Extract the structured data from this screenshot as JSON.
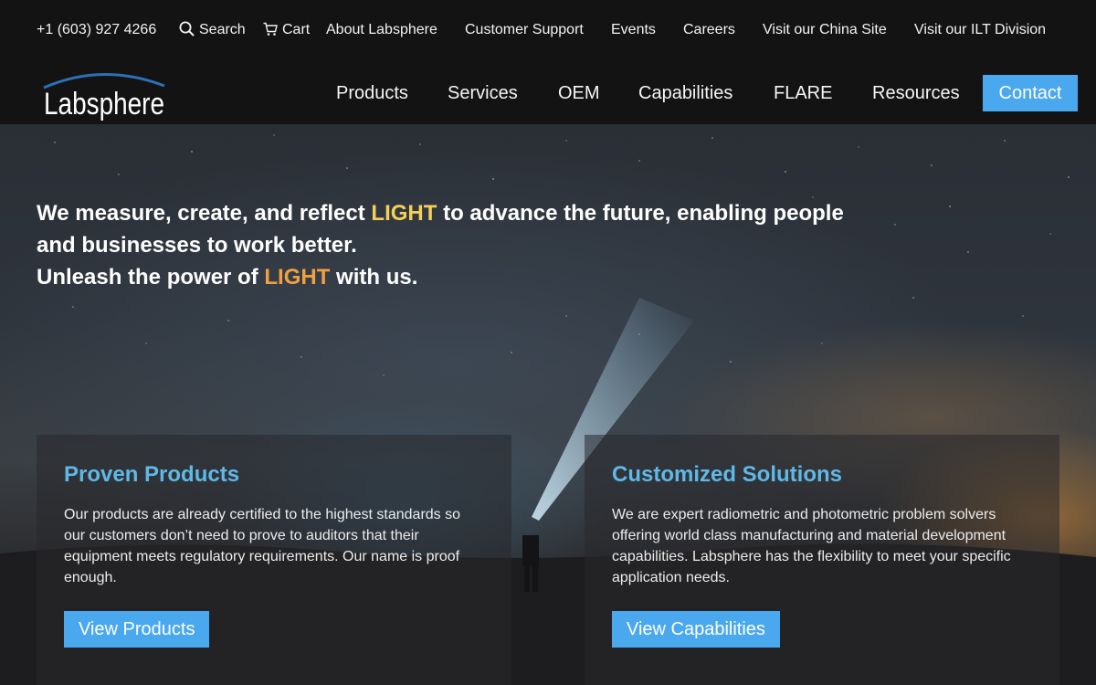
{
  "topbar": {
    "phone": "+1 (603) 927 4266",
    "search": "Search",
    "cart": "Cart",
    "about": "About Labsphere",
    "support": "Customer Support",
    "events": "Events",
    "careers": "Careers",
    "china": "Visit our China Site",
    "ilt": "Visit our ILT Division"
  },
  "brand": {
    "logo_text": "Labsphere",
    "accent": "#4aa8ef"
  },
  "nav": {
    "products": "Products",
    "services": "Services",
    "oem": "OEM",
    "capabilities": "Capabilities",
    "flare": "FLARE",
    "resources": "Resources",
    "contact": "Contact"
  },
  "hero": {
    "line1_a": "We measure, create, and reflect ",
    "line1_light": "LIGHT",
    "line1_b": " to advance the future, enabling people and businesses to work better.",
    "line2_a": "Unleash the power of ",
    "line2_light": "LIGHT",
    "line2_b": " with us."
  },
  "panels": {
    "left": {
      "title": "Proven Products",
      "body": "Our products are already certified to the highest standards so our customers don’t need to prove to auditors that their equipment meets regulatory requirements. Our name is proof enough.",
      "button": "View Products"
    },
    "right": {
      "title": "Customized Solutions",
      "body": "We are expert radiometric and photometric problem solvers offering world class manufacturing and material development capabilities. Labsphere has the flexibility to meet your specific application needs.",
      "button": "View Capabilities"
    }
  },
  "colors": {
    "title_blue": "#5fb8e6",
    "light_yellow": "#f3d05a",
    "light_orange": "#f0a040",
    "button_blue": "#4aa8ef"
  }
}
